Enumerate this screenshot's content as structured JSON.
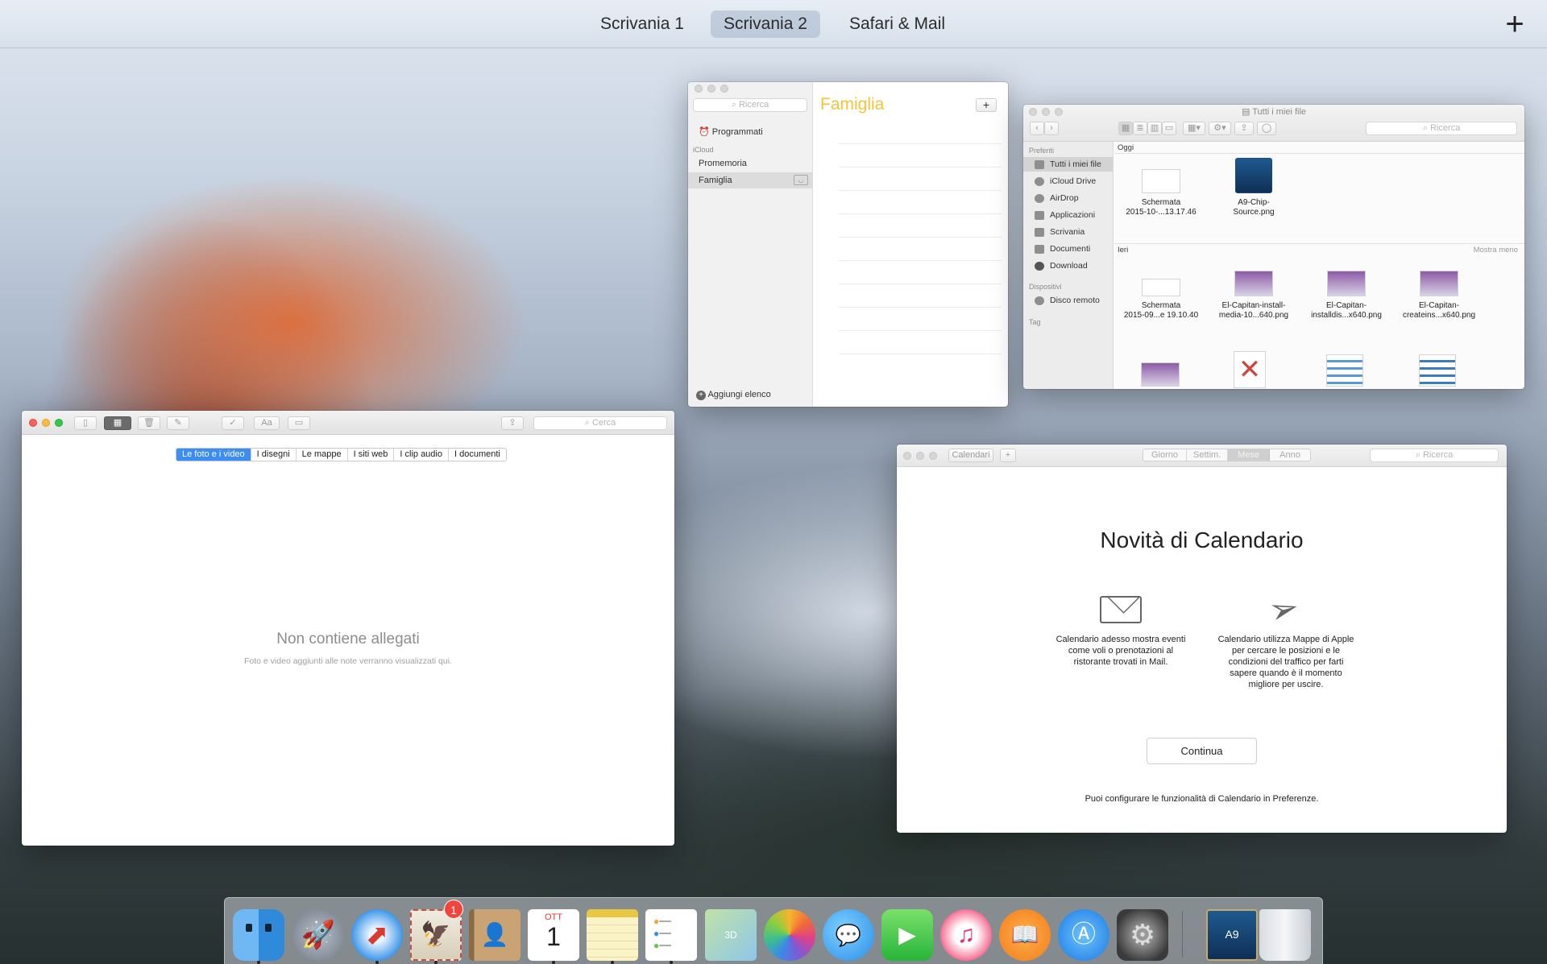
{
  "spaces": {
    "tabs": [
      {
        "label": "Scrivania 1"
      },
      {
        "label": "Scrivania 2",
        "active": true
      },
      {
        "label": "Safari & Mail"
      }
    ],
    "add_label": "+"
  },
  "reminders": {
    "search_placeholder": "Ricerca",
    "scheduled": "Programmati",
    "group_icloud": "iCloud",
    "lists": [
      "Promemoria",
      "Famiglia"
    ],
    "selected_list": "Famiglia",
    "list_title": "Famiglia",
    "add_list": "Aggiungi elenco",
    "add_button": "+",
    "accent": "#f7c338"
  },
  "finder": {
    "title": "Tutti i miei file",
    "search_placeholder": "Ricerca",
    "favorites_label": "Preferiti",
    "favorites": [
      "Tutti i miei file",
      "iCloud Drive",
      "AirDrop",
      "Applicazioni",
      "Scrivania",
      "Documenti",
      "Download"
    ],
    "devices_label": "Dispositivi",
    "devices": [
      "Disco remoto"
    ],
    "tags_label": "Tag",
    "section_today": "Oggi",
    "section_yesterday": "Ieri",
    "show_less": "Mostra meno",
    "today_files": [
      {
        "name1": "Schermata",
        "name2": "2015-10-...13.17.46"
      },
      {
        "name1": "A9-Chip-",
        "name2": "Source.png"
      }
    ],
    "yesterday_files": [
      {
        "name1": "Schermata",
        "name2": "2015-09...e 19.10.40"
      },
      {
        "name1": "El-Capitan-install-",
        "name2": "media-10...640.png"
      },
      {
        "name1": "El-Capitan-",
        "name2": "installdis...x640.png"
      },
      {
        "name1": "El-Capitan-",
        "name2": "createins...x640.png"
      }
    ]
  },
  "notes": {
    "search_placeholder": "Cerca",
    "font_button": "Aa",
    "tabs": [
      "Le foto e i video",
      "I disegni",
      "Le mappe",
      "I siti web",
      "I clip audio",
      "I documenti"
    ],
    "selected_tab": "Le foto e i video",
    "empty_title": "Non contiene allegati",
    "empty_subtitle": "Foto e video aggiunti alle note verranno visualizzati qui.",
    "accent": "#3b8cf5"
  },
  "calendar": {
    "toolbar_calendars": "Calendari",
    "toolbar_add": "+",
    "views": [
      "Giorno",
      "Settim.",
      "Mese",
      "Anno"
    ],
    "search_placeholder": "Ricerca",
    "heading": "Novità di Calendario",
    "feature1": "Calendario adesso mostra eventi come voli o prenotazioni al ristorante trovati in Mail.",
    "feature2": "Calendario utilizza Mappe di Apple per cercare le posizioni e le condizioni del traffico per farti sapere quando è il momento migliore per uscire.",
    "continue_label": "Continua",
    "footer": "Puoi configurare le funzionalità di Calendario in Preferenze."
  },
  "dock": {
    "apps": [
      "finder",
      "launchpad",
      "safari",
      "mail",
      "contacts",
      "calendar",
      "notes",
      "reminders",
      "maps",
      "photos",
      "messages",
      "facetime",
      "itunes",
      "ibooks",
      "app-store",
      "system-preferences"
    ],
    "mail_badge": "1",
    "calendar_month": "OTT",
    "calendar_day": "1",
    "a9_label": "A9"
  }
}
